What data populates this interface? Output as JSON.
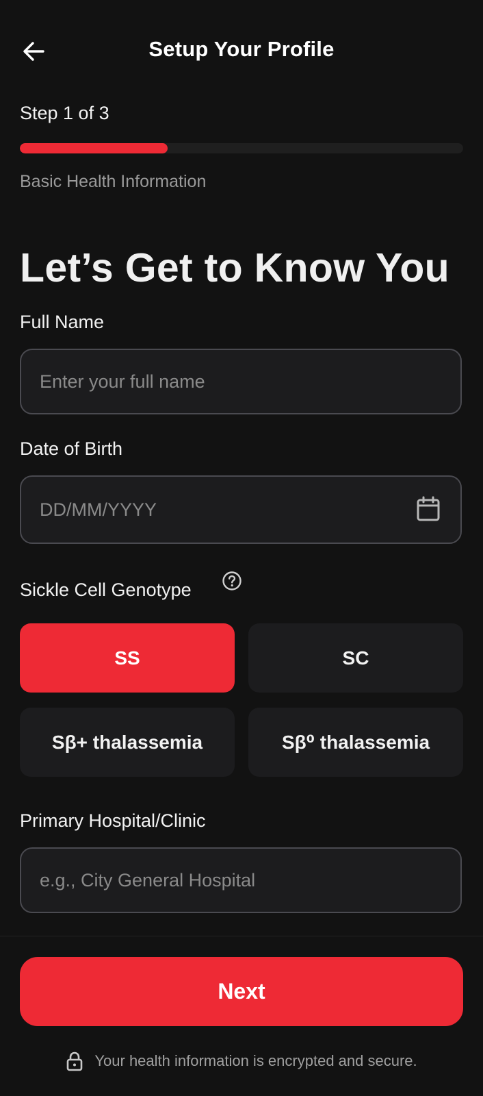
{
  "header": {
    "title": "Setup Your Profile",
    "back_icon": "arrow-left-icon"
  },
  "progress": {
    "step_label": "Step 1 of 3",
    "current_step": 1,
    "total_steps": 3,
    "fraction": 0.333,
    "subtitle": "Basic Health Information",
    "colors": {
      "fill": "#ee2a35",
      "track": "#1f1f1f"
    }
  },
  "main": {
    "heading": "Let’s Get to Know You",
    "full_name": {
      "label": "Full Name",
      "value": "",
      "placeholder": "Enter your full name"
    },
    "dob": {
      "label": "Date of Birth",
      "value": "",
      "placeholder": "DD/MM/YYYY",
      "icon": "calendar-icon"
    },
    "genotype": {
      "label": "Sickle Cell Genotype",
      "help_icon": "help-circle-icon",
      "selected": "SS",
      "options": [
        "SS",
        "SC",
        "Sβ+ thalassemia",
        "Sβ⁰ thalassemia"
      ]
    },
    "hospital": {
      "label": "Primary Hospital/Clinic",
      "value": "",
      "placeholder": "e.g., City General Hospital"
    }
  },
  "footer": {
    "next_label": "Next",
    "secure_text": "Your health information is encrypted and secure.",
    "lock_icon": "lock-icon"
  },
  "colors": {
    "accent": "#ee2a35",
    "background": "#121212",
    "surface": "#1c1c1e"
  }
}
